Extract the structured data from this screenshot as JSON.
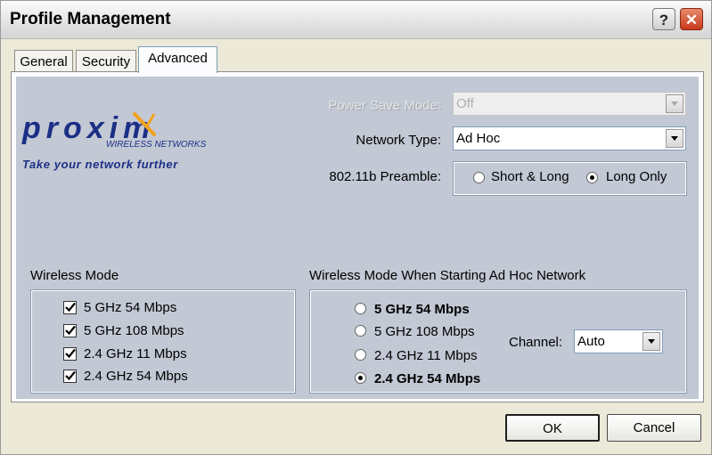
{
  "window": {
    "title": "Profile Management"
  },
  "tabs": [
    {
      "label": "General",
      "active": false
    },
    {
      "label": "Security",
      "active": false
    },
    {
      "label": "Advanced",
      "active": true
    }
  ],
  "logo": {
    "brand": "proxim",
    "sub": "WIRELESS NETWORKS",
    "tagline": "Take your network further"
  },
  "power_save": {
    "label": "Power Save Mode:",
    "value": "Off",
    "disabled": true
  },
  "network_type": {
    "label": "Network Type:",
    "value": "Ad Hoc"
  },
  "preamble": {
    "label": "802.11b Preamble:",
    "options": [
      {
        "label": "Short & Long",
        "selected": false
      },
      {
        "label": "Long Only",
        "selected": true
      }
    ]
  },
  "wireless_mode": {
    "title": "Wireless Mode",
    "options": [
      {
        "label": "5 GHz 54 Mbps",
        "checked": true
      },
      {
        "label": "5 GHz 108 Mbps",
        "checked": true
      },
      {
        "label": "2.4 GHz 11 Mbps",
        "checked": true
      },
      {
        "label": "2.4 GHz 54 Mbps",
        "checked": true
      }
    ]
  },
  "adhoc_mode": {
    "title": "Wireless Mode When Starting Ad Hoc Network",
    "options": [
      {
        "label": "5 GHz 54 Mbps",
        "selected": false
      },
      {
        "label": "5 GHz 108 Mbps",
        "selected": false
      },
      {
        "label": "2.4 GHz 11 Mbps",
        "selected": false
      },
      {
        "label": "2.4 GHz 54 Mbps",
        "selected": true
      }
    ],
    "channel_label": "Channel:",
    "channel_value": "Auto"
  },
  "buttons": {
    "ok": "OK",
    "cancel": "Cancel"
  },
  "colors": {
    "panel": "#c2c8d4",
    "logo_blue": "#1c2f86",
    "logo_orange": "#f2a31b"
  }
}
